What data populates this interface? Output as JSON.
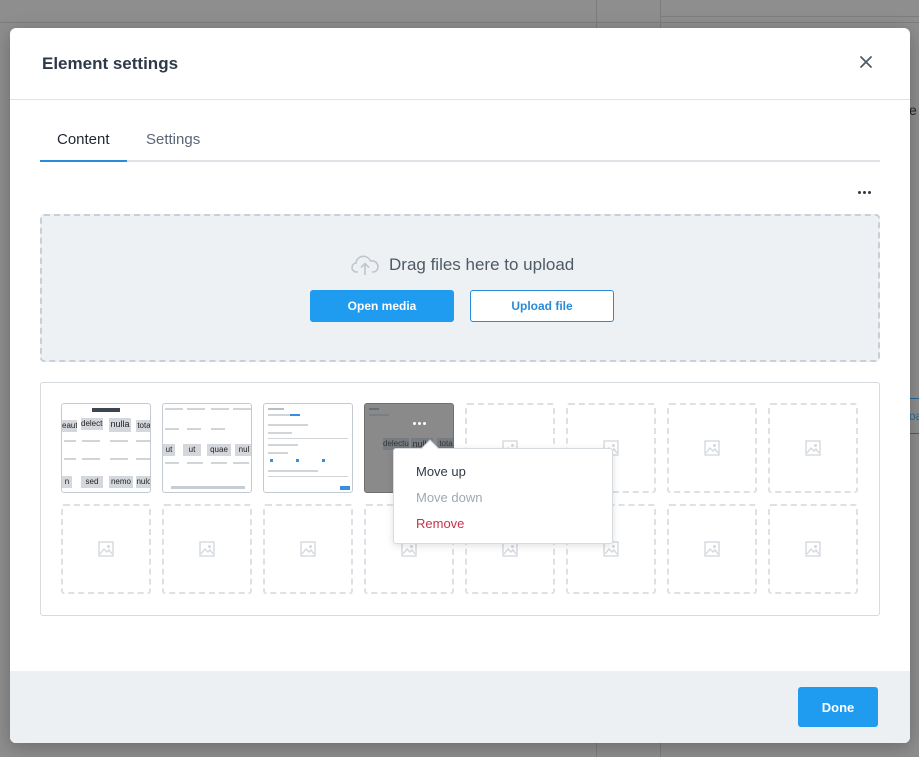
{
  "background": {
    "partial_text": "e",
    "partial_button_text": "oa"
  },
  "modal": {
    "title": "Element settings",
    "close_icon": "close-icon"
  },
  "tabs": [
    {
      "label": "Content",
      "active": true
    },
    {
      "label": "Settings",
      "active": false
    }
  ],
  "more_icon": "more-horizontal-icon",
  "dropzone": {
    "icon": "cloud-upload-icon",
    "label": "Drag files here to upload",
    "open_media_label": "Open media",
    "upload_file_label": "Upload file"
  },
  "gallery": {
    "placeholder_icon": "image-placeholder-icon",
    "thumb1": [
      "eaute",
      "delectus",
      "nulla",
      "tota",
      "n",
      "sed",
      "nemo",
      "nulo"
    ],
    "thumb2": [
      "ut",
      "ut",
      "quae",
      "nul"
    ],
    "thumb4": [
      "delectus",
      "nulla",
      "tota"
    ]
  },
  "context_menu": {
    "move_up": "Move up",
    "move_down": "Move down",
    "remove": "Remove"
  },
  "footer": {
    "done_label": "Done"
  },
  "colors": {
    "primary": "#1f9bf0",
    "danger": "#c8324c",
    "disabled": "#a0a8b2"
  }
}
